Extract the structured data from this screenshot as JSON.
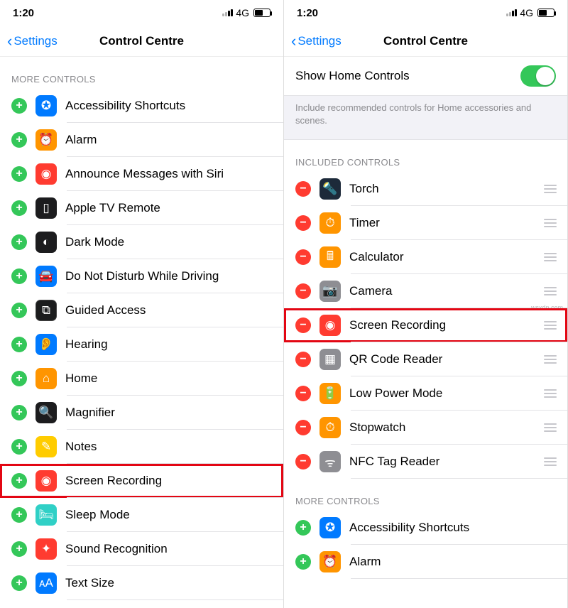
{
  "status": {
    "time": "1:20",
    "network": "4G"
  },
  "nav": {
    "back": "Settings",
    "title": "Control Centre"
  },
  "left": {
    "section": "More Controls",
    "items": [
      {
        "label": "Accessibility Shortcuts",
        "iconColor": "ic-blue",
        "glyph": "✪"
      },
      {
        "label": "Alarm",
        "iconColor": "ic-orange",
        "glyph": "⏰"
      },
      {
        "label": "Announce Messages with Siri",
        "iconColor": "ic-red",
        "glyph": "◉"
      },
      {
        "label": "Apple TV Remote",
        "iconColor": "ic-black",
        "glyph": "▯"
      },
      {
        "label": "Dark Mode",
        "iconColor": "ic-black",
        "glyph": "◐"
      },
      {
        "label": "Do Not Disturb While Driving",
        "iconColor": "ic-blue",
        "glyph": "🚘"
      },
      {
        "label": "Guided Access",
        "iconColor": "ic-darkb",
        "glyph": "⧉"
      },
      {
        "label": "Hearing",
        "iconColor": "ic-blue",
        "glyph": "👂"
      },
      {
        "label": "Home",
        "iconColor": "ic-orange",
        "glyph": "⌂"
      },
      {
        "label": "Magnifier",
        "iconColor": "ic-black",
        "glyph": "🔍"
      },
      {
        "label": "Notes",
        "iconColor": "ic-yellow",
        "glyph": "✎"
      },
      {
        "label": "Screen Recording",
        "iconColor": "ic-red",
        "glyph": "◉",
        "hl": true
      },
      {
        "label": "Sleep Mode",
        "iconColor": "ic-teal",
        "glyph": "🛏"
      },
      {
        "label": "Sound Recognition",
        "iconColor": "ic-red",
        "glyph": "✦"
      },
      {
        "label": "Text Size",
        "iconColor": "ic-bluebox",
        "glyph": "ᴀA"
      }
    ]
  },
  "right": {
    "showHome": {
      "label": "Show Home Controls",
      "footer": "Include recommended controls for Home accessories and scenes."
    },
    "includedHeader": "Included Controls",
    "included": [
      {
        "label": "Torch",
        "iconColor": "ic-darknavy",
        "glyph": "🔦"
      },
      {
        "label": "Timer",
        "iconColor": "ic-orange",
        "glyph": "⏱"
      },
      {
        "label": "Calculator",
        "iconColor": "ic-orange",
        "glyph": "🖩"
      },
      {
        "label": "Camera",
        "iconColor": "ic-grey",
        "glyph": "📷"
      },
      {
        "label": "Screen Recording",
        "iconColor": "ic-red",
        "glyph": "◉",
        "hl": true
      },
      {
        "label": "QR Code Reader",
        "iconColor": "ic-grey",
        "glyph": "▦"
      },
      {
        "label": "Low Power Mode",
        "iconColor": "ic-orange",
        "glyph": "🔋"
      },
      {
        "label": "Stopwatch",
        "iconColor": "ic-orange",
        "glyph": "⏱"
      },
      {
        "label": "NFC Tag Reader",
        "iconColor": "ic-grey",
        "glyph": "ᯤ"
      }
    ],
    "moreHeader": "More Controls",
    "more": [
      {
        "label": "Accessibility Shortcuts",
        "iconColor": "ic-blue",
        "glyph": "✪"
      },
      {
        "label": "Alarm",
        "iconColor": "ic-orange",
        "glyph": "⏰"
      }
    ]
  },
  "watermark": "wsxdn.com"
}
